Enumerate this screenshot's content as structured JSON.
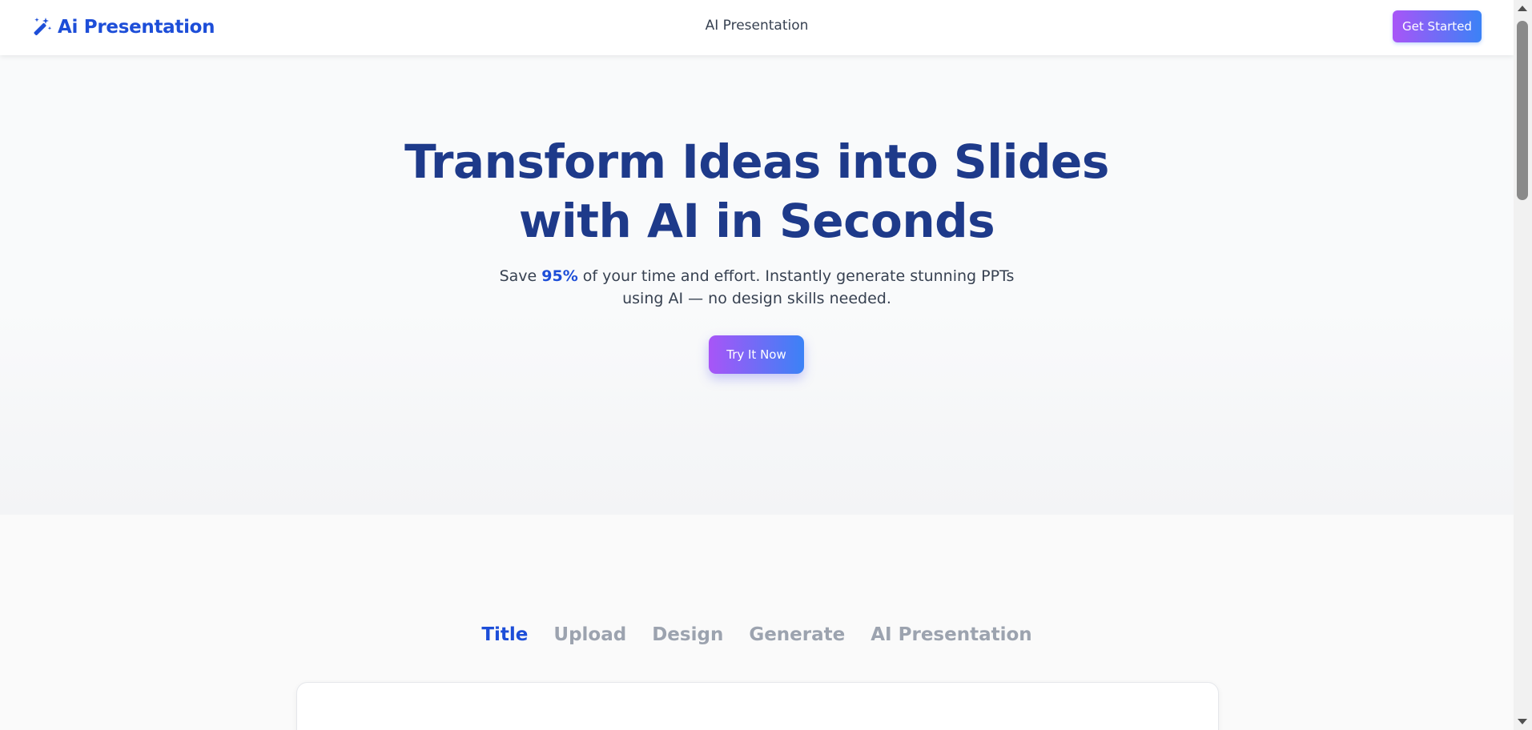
{
  "header": {
    "logo_text": "Ai Presentation",
    "logo_icon": "magic-wand-icon",
    "nav_center": "AI Presentation",
    "cta_label": "Get Started"
  },
  "hero": {
    "title_line1": "Transform Ideas into Slides",
    "title_line2": "with AI in Seconds",
    "subtitle_prefix": "Save ",
    "subtitle_highlight": "95%",
    "subtitle_suffix": " of your time and effort. Instantly generate stunning PPTs using AI — no design skills needed.",
    "cta_label": "Try It Now"
  },
  "steps": {
    "tabs": [
      {
        "label": "Title",
        "active": true
      },
      {
        "label": "Upload",
        "active": false
      },
      {
        "label": "Design",
        "active": false
      },
      {
        "label": "Generate",
        "active": false
      },
      {
        "label": "AI Presentation",
        "active": false
      }
    ]
  },
  "colors": {
    "brand": "#1d4ed8",
    "heading": "#1e3a8a",
    "gradient_start": "#a855f7",
    "gradient_end": "#3b82f6",
    "inactive_tab": "#9ca3af"
  }
}
